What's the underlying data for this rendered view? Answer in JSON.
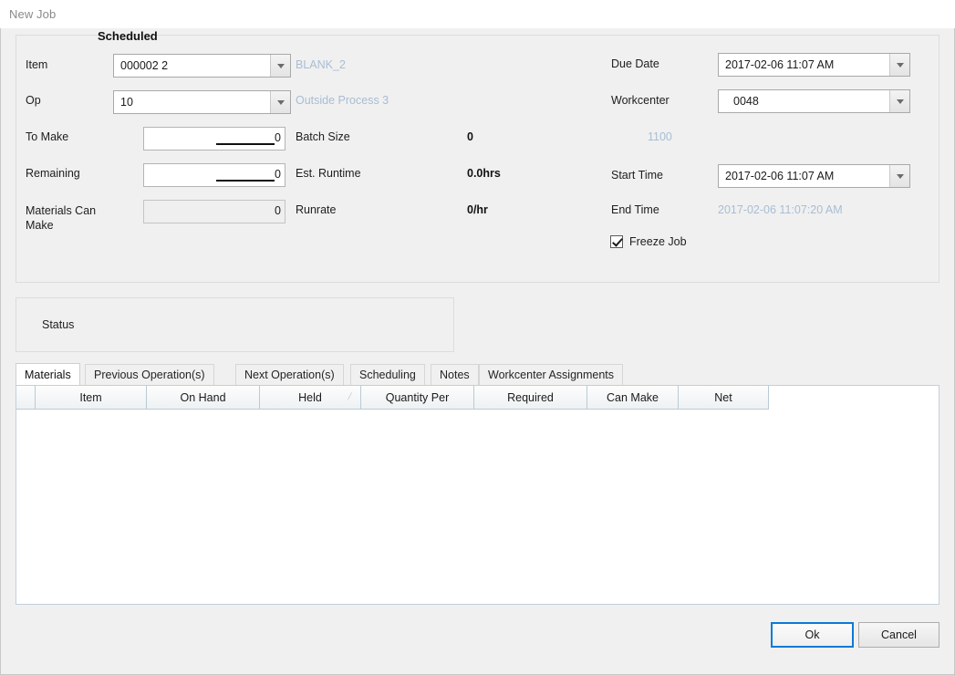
{
  "window": {
    "title": "New Job"
  },
  "form": {
    "item": {
      "label": "Item",
      "value": "000002 2",
      "description": "BLANK_2"
    },
    "op": {
      "label": "Op",
      "value": "10",
      "description": "Outside Process 3"
    },
    "to_make": {
      "label": "To Make",
      "value": "0"
    },
    "remaining": {
      "label": "Remaining",
      "value": "0"
    },
    "materials_can_make": {
      "label": "Materials Can Make",
      "label_line1": "Materials Can",
      "label_line2": "Make",
      "value": "0"
    },
    "batch_size": {
      "label": "Batch Size",
      "value": "0"
    },
    "est_runtime": {
      "label": "Est. Runtime",
      "value": "0.0hrs"
    },
    "runrate": {
      "label": "Runrate",
      "value": "0/hr"
    },
    "due_date": {
      "label": "Due Date",
      "value": "2017-02-06 11:07 AM"
    },
    "workcenter": {
      "label": "Workcenter",
      "value": "0048",
      "description": "1100"
    },
    "start_time": {
      "label": "Start Time",
      "value": "2017-02-06 11:07 AM"
    },
    "end_time": {
      "label": "End Time",
      "value": "2017-02-06 11:07:20 AM"
    },
    "freeze_job": {
      "label": "Freeze Job",
      "checked": true
    }
  },
  "status": {
    "label": "Status",
    "value": "Scheduled"
  },
  "tabs": [
    {
      "label": "Materials",
      "active": true
    },
    {
      "label": "Previous Operation(s)",
      "active": false
    },
    {
      "label": "Next Operation(s)",
      "active": false
    },
    {
      "label": "Scheduling",
      "active": false
    },
    {
      "label": "Notes",
      "active": false
    },
    {
      "label": "Workcenter Assignments",
      "active": false
    }
  ],
  "grid": {
    "columns": [
      {
        "label": "Item",
        "sort_mark": ""
      },
      {
        "label": "On Hand",
        "sort_mark": ""
      },
      {
        "label": "Held",
        "sort_mark": "∕"
      },
      {
        "label": "Quantity Per",
        "sort_mark": ""
      },
      {
        "label": "Required",
        "sort_mark": ""
      },
      {
        "label": "Can Make",
        "sort_mark": ""
      },
      {
        "label": "Net",
        "sort_mark": ""
      }
    ],
    "rows": []
  },
  "footer": {
    "ok_label": "Ok",
    "cancel_label": "Cancel"
  },
  "colors": {
    "accent": "#0b7ad6",
    "dim_text": "#a8bdd4",
    "panel_bg": "#f0f0f0",
    "grid_border": "#c3cfdc"
  }
}
